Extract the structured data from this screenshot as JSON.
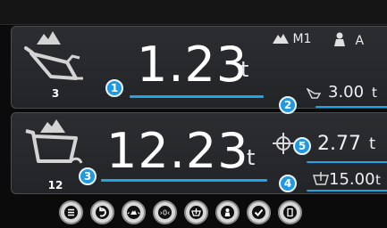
{
  "top_panel": {
    "count": "3",
    "weight_value": "1.23",
    "weight_unit": "t",
    "mode_label": "M1",
    "auto_label": "A",
    "target_value": "3.00",
    "target_unit": "t",
    "badge_weight": "1",
    "badge_target": "2",
    "icon": "truck-load-icon"
  },
  "bottom_panel": {
    "count": "12",
    "weight_value": "12.23",
    "weight_unit": "t",
    "remaining_value": "2.77",
    "remaining_unit": "t",
    "bucket_value": "15.00",
    "bucket_unit": "t",
    "badge_weight": "3",
    "badge_bucket": "4",
    "badge_remaining": "5",
    "icon": "cart-load-icon"
  },
  "softkeys": [
    "list-menu-icon",
    "undo-icon",
    "pile-adjust-icon",
    "zero-icon",
    "bucket-icon",
    "operator-icon",
    "confirm-icon",
    "note-icon"
  ],
  "colors": {
    "accent_blue": "#1fa4e8",
    "panel_bg": "#2b2d30",
    "background": "#0b0b0b"
  }
}
